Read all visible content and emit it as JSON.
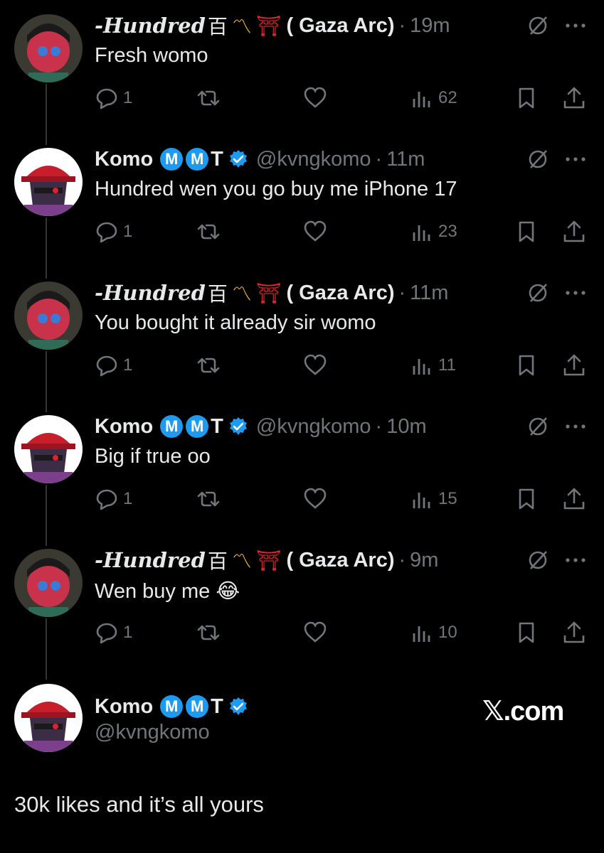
{
  "tweets": [
    {
      "author": "-Hundred",
      "kanji": "百",
      "tail": "( Gaza Arc)",
      "handle": "",
      "time": "19m",
      "text": "Fresh womo",
      "replies": "1",
      "views": "62",
      "avatar": "hundred"
    },
    {
      "author": "Komo",
      "badge1": "M",
      "badge2": "M",
      "t": "T",
      "handle": "@kvngkomo",
      "time": "11m",
      "text": "Hundred wen you go buy me iPhone 17",
      "replies": "1",
      "views": "23",
      "avatar": "komo"
    },
    {
      "author": "-Hundred",
      "kanji": "百",
      "tail": "( Gaza Arc)",
      "handle": "",
      "time": "11m",
      "text": "You bought it already sir womo",
      "replies": "1",
      "views": "11",
      "avatar": "hundred"
    },
    {
      "author": "Komo",
      "badge1": "M",
      "badge2": "M",
      "t": "T",
      "handle": "@kvngkomo",
      "time": "10m",
      "text": "Big if true oo",
      "replies": "1",
      "views": "15",
      "avatar": "komo"
    },
    {
      "author": "-Hundred",
      "kanji": "百",
      "tail": "( Gaza Arc)",
      "handle": "",
      "time": "9m",
      "text": "Wen buy me 😂",
      "replies": "1",
      "views": "10",
      "avatar": "hundred"
    }
  ],
  "final_post": {
    "author": "Komo",
    "badge1": "M",
    "badge2": "M",
    "t": "T",
    "handle": "@kvngkomo",
    "brand": "𝕏.com",
    "text": "30k likes and it’s all yours"
  },
  "colors": {
    "background": "#000000",
    "text": "#e7e9ea",
    "muted": "#71767b",
    "accent": "#1d9bf0"
  }
}
